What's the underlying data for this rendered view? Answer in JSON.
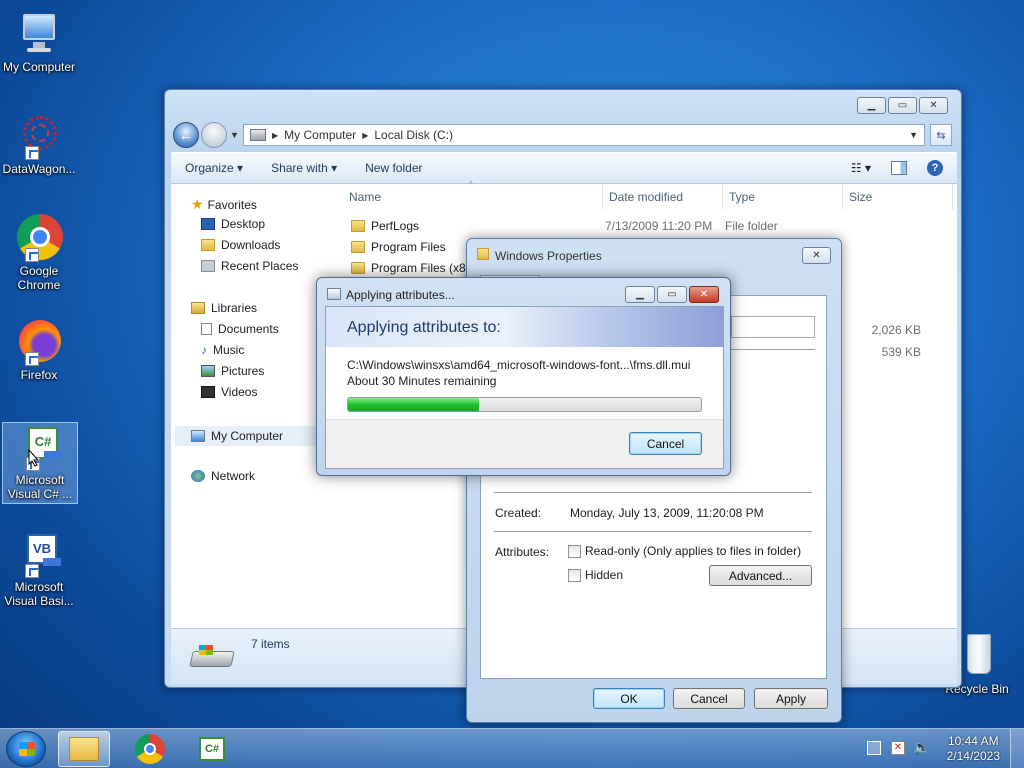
{
  "desktop": {
    "icons": [
      {
        "label": "My Computer"
      },
      {
        "label": "DataWagon..."
      },
      {
        "label": "Google Chrome"
      },
      {
        "label": "Firefox"
      },
      {
        "label": "Microsoft Visual C# ..."
      },
      {
        "label": "Microsoft Visual Basi..."
      },
      {
        "label": "Recycle Bin"
      }
    ]
  },
  "explorer": {
    "address": {
      "segments": [
        "My Computer",
        "Local Disk (C:)"
      ]
    },
    "toolbar": {
      "organize": "Organize",
      "share_with": "Share with",
      "new_folder": "New folder"
    },
    "nav": {
      "favorites": "Favorites",
      "desktop": "Desktop",
      "downloads": "Downloads",
      "recent_places": "Recent Places",
      "libraries": "Libraries",
      "documents": "Documents",
      "music": "Music",
      "pictures": "Pictures",
      "videos": "Videos",
      "my_computer": "My Computer",
      "network": "Network"
    },
    "columns": {
      "name": "Name",
      "date_modified": "Date modified",
      "type": "Type",
      "size": "Size"
    },
    "files": [
      {
        "name": "PerfLogs",
        "date": "7/13/2009 11:20 PM",
        "type": "File folder"
      },
      {
        "name": "Program Files"
      },
      {
        "name": "Program Files (x86"
      }
    ],
    "sizes": [
      "2,026 KB",
      "539 KB"
    ],
    "status": {
      "items": "7 items"
    }
  },
  "properties": {
    "title": "Windows Properties",
    "created_label": "Created:",
    "created_value": "Monday, July 13, 2009, 11:20:08 PM",
    "attributes_label": "Attributes:",
    "readonly": "Read-only (Only applies to files in folder)",
    "hidden": "Hidden",
    "advanced": "Advanced...",
    "ok": "OK",
    "cancel": "Cancel",
    "apply": "Apply"
  },
  "progress_dialog": {
    "title": "Applying attributes...",
    "heading": "Applying attributes to:",
    "path": "C:\\Windows\\winsxs\\amd64_microsoft-windows-font...\\fms.dll.mui",
    "remaining": "About 30 Minutes remaining",
    "progress_percent": 37,
    "cancel": "Cancel"
  },
  "taskbar": {
    "time": "10:44 AM",
    "date": "2/14/2023"
  },
  "colors": {
    "accent": "#1c6cc6",
    "progress": "#23c131"
  }
}
